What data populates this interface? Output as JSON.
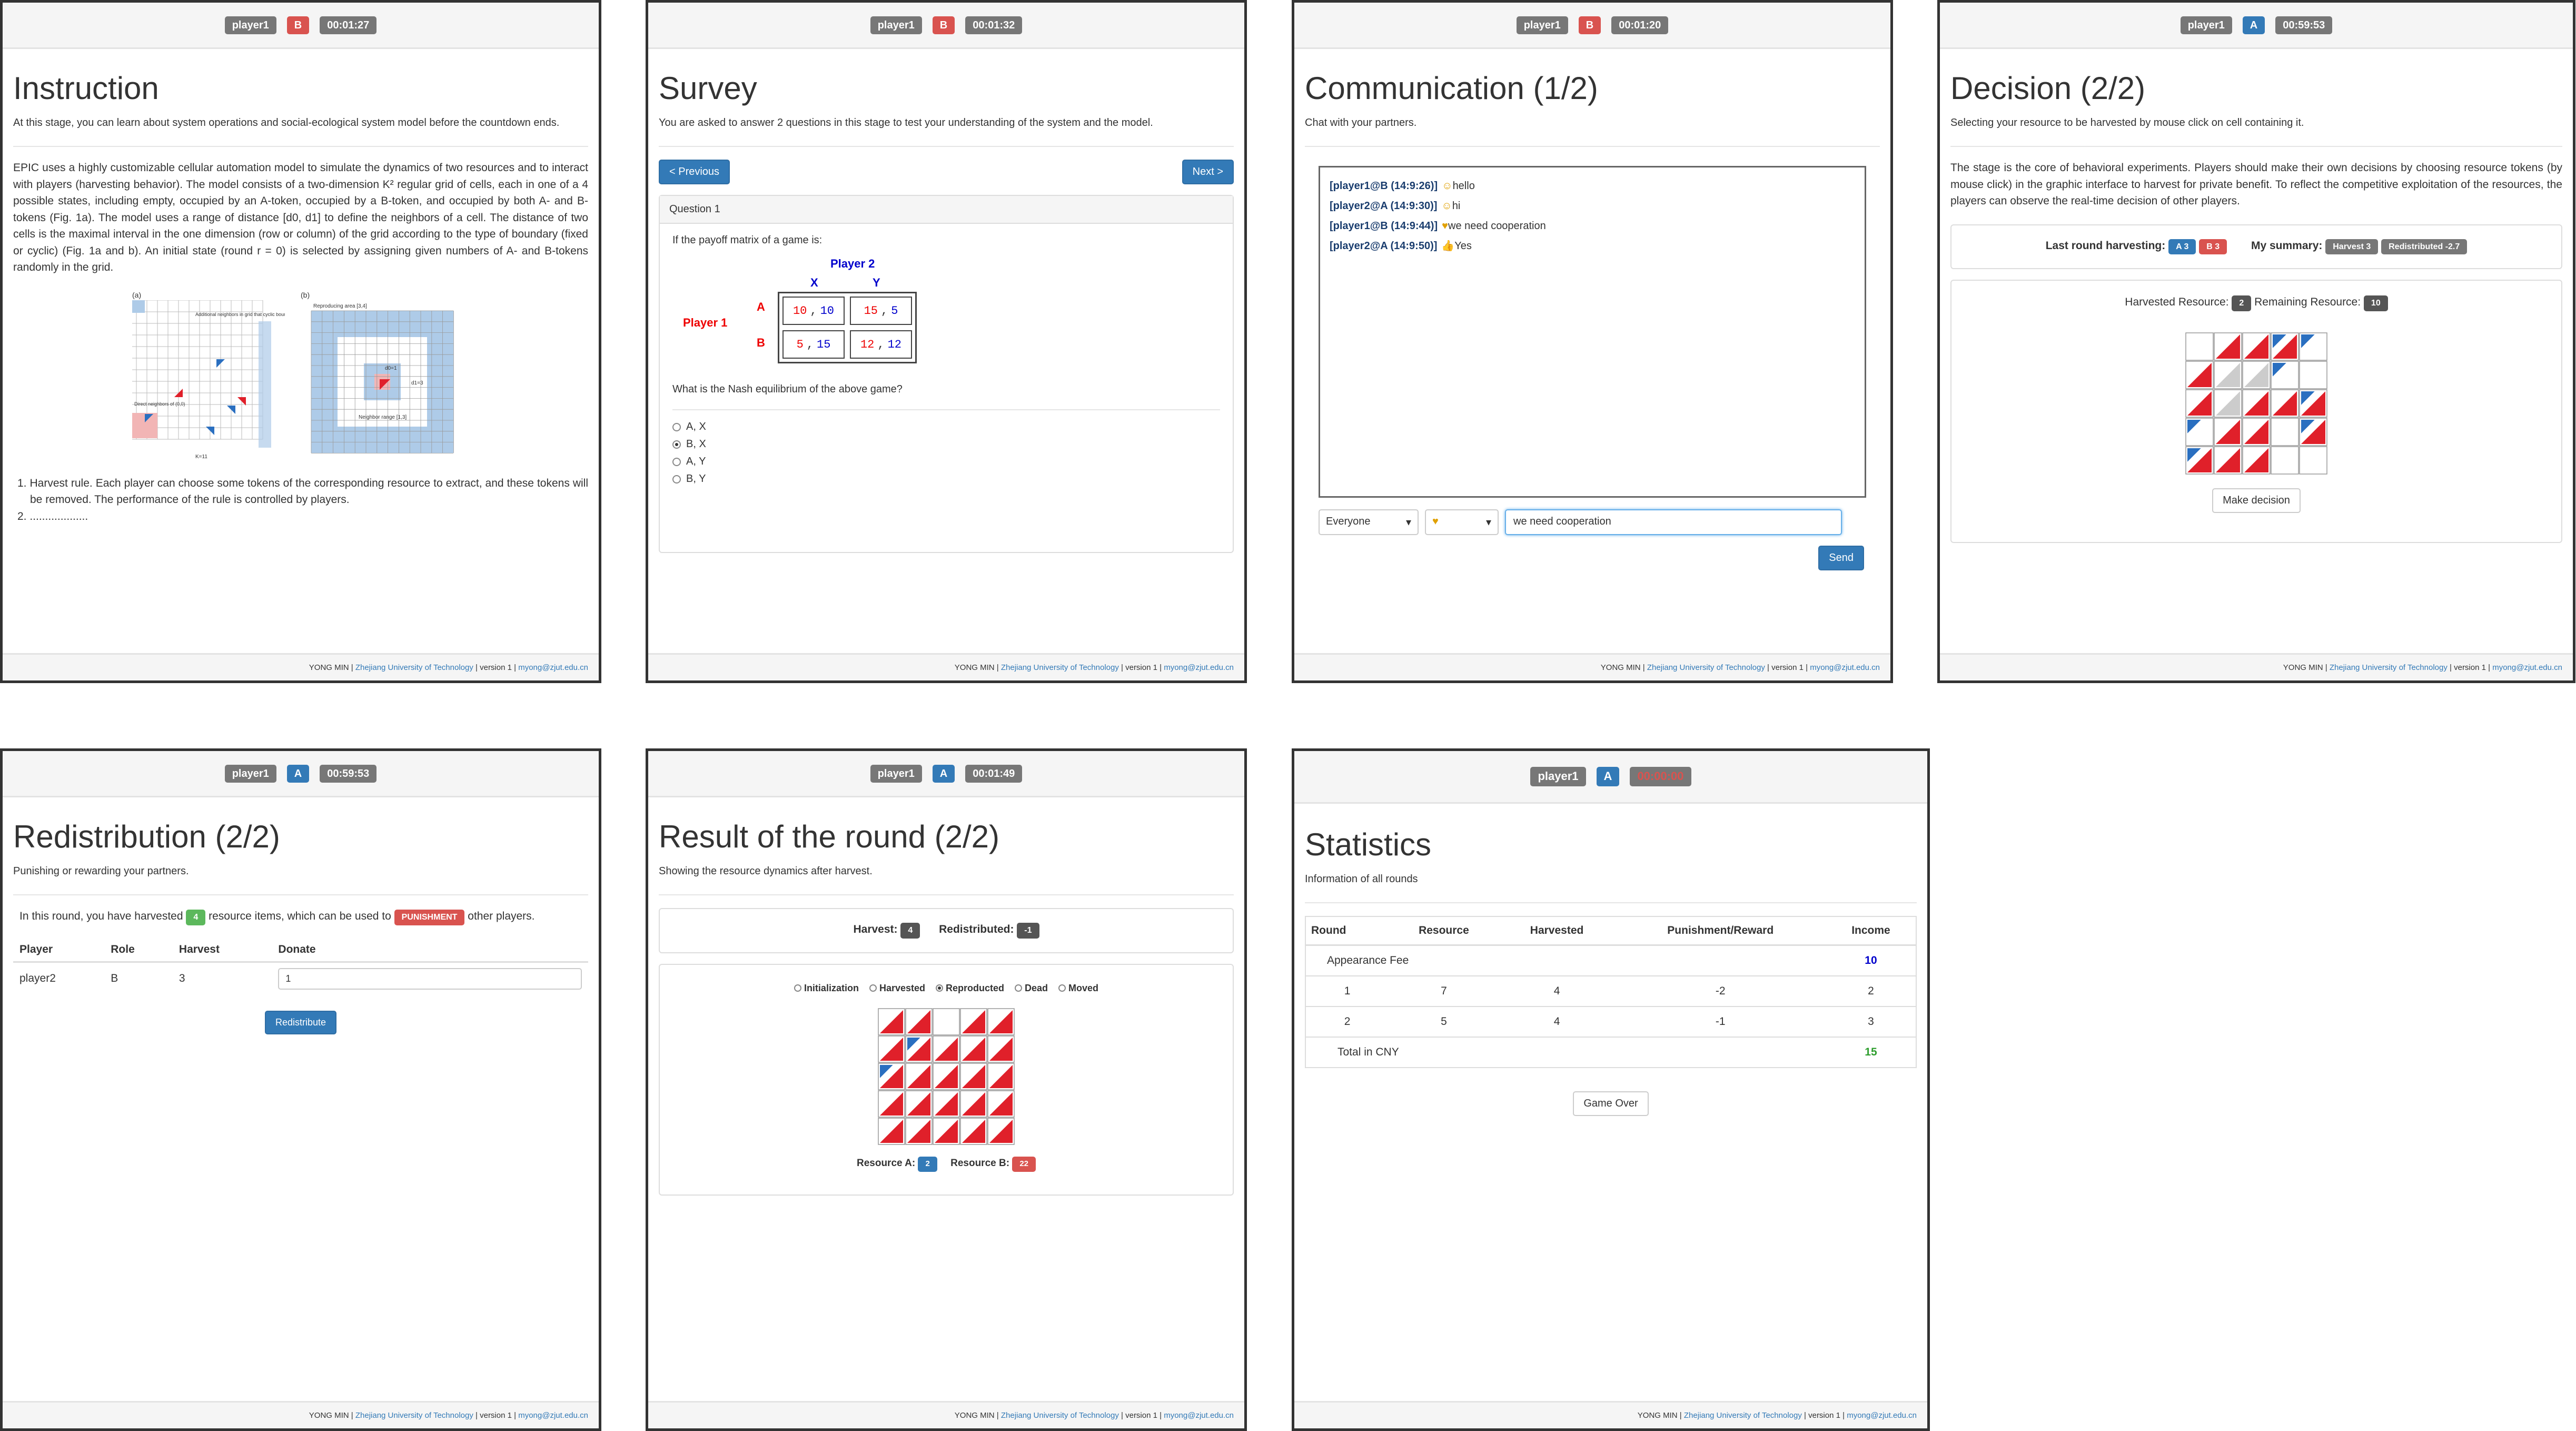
{
  "footer": {
    "author": "YONG MIN |",
    "org": "Zhejiang University of Technology",
    "version": "| version 1 |",
    "email": "myong@zjut.edu.cn"
  },
  "panels": {
    "instruction": {
      "player": "player1",
      "role": "B",
      "timer": "00:01:27",
      "title": "Instruction",
      "subtitle": "At this stage, you can learn about system operations and social-ecological system model before the countdown ends.",
      "paragraph": "EPIC uses a highly customizable cellular automation model to simulate the dynamics of two resources and to interact with players (harvesting behavior). The model consists of a two-dimension K² regular grid of cells, each in one of a 4 possible states, including empty, occupied by an A-token, occupied by a B-token, and occupied by both A- and B-tokens (Fig. 1a). The model uses a range of distance [d0, d1] to define the neighbors of a cell. The distance of two cells is the maximal interval in the one dimension (row or column) of the grid according to the type of boundary (fixed or cyclic) (Fig. 1a and b). An initial state (round r = 0) is selected by assigning given numbers of A- and B-tokens randomly in the grid.",
      "fig_a": "(a)",
      "fig_b": "(b)",
      "fig_a_note1": "Additional neighbors in grid that cyclic boundary",
      "fig_a_note2": "Direct neighbors of (0,0)",
      "fig_a_k": "K=11",
      "fig_b_note1": "Reproducing area [3,4]",
      "fig_b_note2": "Neighbor range [1,3]",
      "fig_b_d0": "d0=1",
      "fig_b_d1": "d1=3",
      "list1": "1. Harvest rule. Each player can choose some tokens of the corresponding resource to extract, and these tokens will be removed. The performance of the rule is controlled by players.",
      "list2": "2. ..................."
    },
    "survey": {
      "player": "player1",
      "role": "B",
      "timer": "00:01:32",
      "title": "Survey",
      "subtitle": "You are asked to answer 2 questions in this stage to test your understanding of the system and the model.",
      "prev": "< Previous",
      "next": "Next >",
      "qhead": "Question 1",
      "qtext": "If the payoff matrix of a game is:",
      "p2": "Player 2",
      "p1": "Player 1",
      "cx": "X",
      "cy": "Y",
      "ra": "A",
      "rb": "B",
      "m": {
        "ax1": "10",
        "ax2": "10",
        "ay1": "15",
        "ay2": "5",
        "bx1": "5",
        "bx2": "15",
        "by1": "12",
        "by2": "12"
      },
      "q2": "What is the Nash equilibrium of the above game?",
      "options": [
        "A, X",
        "B, X",
        "A, Y",
        "B, Y"
      ],
      "selected": 1
    },
    "communication": {
      "player": "player1",
      "role": "B",
      "timer": "00:01:20",
      "title": "Communication (1/2)",
      "subtitle": "Chat with your partners.",
      "messages": [
        {
          "who": "[player1@B (14:9:26)]",
          "icon": "smile",
          "text": "hello"
        },
        {
          "who": "[player2@A (14:9:30)]",
          "icon": "smile",
          "text": "hi"
        },
        {
          "who": "[player1@B (14:9:44)]",
          "icon": "heart",
          "text": "we need cooperation"
        },
        {
          "who": "[player2@A (14:9:50)]",
          "icon": "thumb",
          "text": "Yes"
        }
      ],
      "recipient": "Everyone",
      "input": "we need cooperation",
      "send": "Send"
    },
    "decision": {
      "player": "player1",
      "role": "A",
      "timer": "00:59:53",
      "title": "Decision (2/2)",
      "subtitle": "Selecting your resource to be harvested by mouse click on cell containing it.",
      "paragraph": "The stage is the core of behavioral experiments. Players should make their own decisions by choosing resource tokens (by mouse click) in the graphic interface to harvest for private benefit. To reflect the competitive exploitation of the resources, the players can observe the real-time decision of other players.",
      "last_label": "Last round harvesting:",
      "last_a": "A 3",
      "last_b": "B 3",
      "sum_label": "My summary:",
      "sum_h": "Harvest 3",
      "sum_r": "Redistributed -2.7",
      "harv_label": "Harvested Resource:",
      "harv_val": "2",
      "rem_label": "Remaining Resource:",
      "rem_val": "10",
      "make": "Make decision"
    },
    "redistribution": {
      "player": "player1",
      "role": "A",
      "timer": "00:59:53",
      "title": "Redistribution (2/2)",
      "subtitle": "Punishing or rewarding your partners.",
      "t1": "In this round, you have harvested",
      "count": "4",
      "t2": "resource items, which can be used to",
      "mode": "PUNISHMENT",
      "t3": "other players.",
      "headers": [
        "Player",
        "Role",
        "Harvest",
        "Donate"
      ],
      "row": [
        "player2",
        "B",
        "3"
      ],
      "donate": "1",
      "button": "Redistribute"
    },
    "result": {
      "player": "player1",
      "role": "A",
      "timer": "00:01:49",
      "title": "Result of the round (2/2)",
      "subtitle": "Showing the resource dynamics after harvest.",
      "harvest_label": "Harvest:",
      "harvest_val": "4",
      "redis_label": "Redistributed:",
      "redis_val": "-1",
      "radios": [
        "Initialization",
        "Harvested",
        "Reproducted",
        "Dead",
        "Moved"
      ],
      "radio_selected": 2,
      "ra_label": "Resource A:",
      "ra_val": "2",
      "rb_label": "Resource B:",
      "rb_val": "22"
    },
    "statistics": {
      "player": "player1",
      "role": "A",
      "timer": "00:00:00",
      "title": "Statistics",
      "subtitle": "Information of all rounds",
      "headers": [
        "Round",
        "Resource",
        "Harvested",
        "Punishment/Reward",
        "Income"
      ],
      "fee_label": "Appearance Fee",
      "fee_val": "10",
      "rows": [
        [
          "1",
          "7",
          "4",
          "-2",
          "2"
        ],
        [
          "2",
          "5",
          "4",
          "-1",
          "3"
        ]
      ],
      "total_label": "Total in CNY",
      "total_val": "15",
      "button": "Game Over"
    }
  },
  "colors": {
    "blue": "#337ab7",
    "red": "#d9534f",
    "green": "#5cb85c",
    "gray": "#777777",
    "cellRed": "#e0202a",
    "cellBlue": "#2a6fc0"
  }
}
